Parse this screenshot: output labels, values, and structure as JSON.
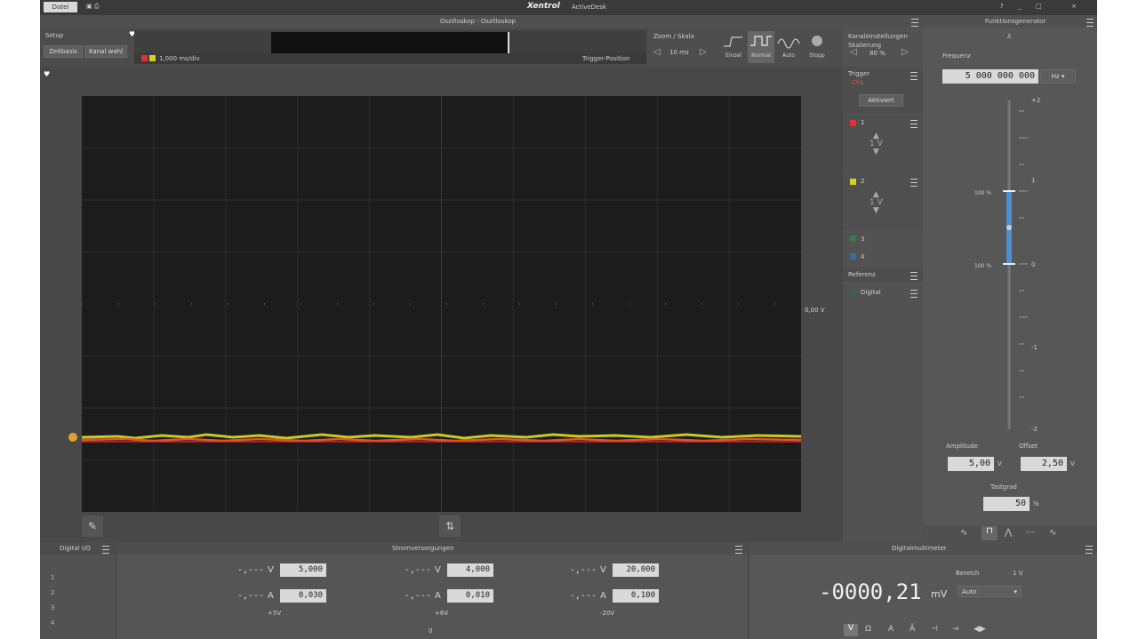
{
  "titlebar": {
    "tab_label": "Datei",
    "logo": "Xentrol",
    "app_name": "ActiveDesk",
    "window_controls": [
      "?",
      "_",
      "□",
      "×"
    ]
  },
  "oscilloscope": {
    "header": "Oszilloskop · Oszilloskop",
    "left_label": "Setup",
    "buttons": [
      "Zeitbasis",
      "Kanal wahl"
    ],
    "timebase_readout": "1,000 ms/div",
    "trigger_position": "Trigger-Position",
    "zoom_label": "Zoom / Skala",
    "zoom_value": "10 ms",
    "mode_buttons": [
      "Einzel",
      "Normal",
      "Auto",
      "Stopp"
    ],
    "right_marker_label": "0,00 V"
  },
  "right_controls": {
    "header": "Kanaleinstellungen",
    "scale_label": "Skalierung",
    "scale_value": "80 %",
    "trigger_label": "Trigger",
    "trigger_sub": "Ch1",
    "trigger_button": "Aktiviert",
    "channels": [
      {
        "label": "1",
        "color": "#e03030",
        "scale": "1 V"
      },
      {
        "label": "2",
        "color": "#d8d020",
        "scale": "1 V"
      }
    ],
    "extra_channels": [
      {
        "label": "3",
        "color": "#3a7a4a"
      },
      {
        "label": "4",
        "color": "#3a6aa0"
      }
    ],
    "reference_label": "Referenz",
    "reference_item": "Digital"
  },
  "generator": {
    "header": "Funktionsgenerator",
    "freq_label": "Frequenz",
    "freq_value": "5 000 000 000",
    "freq_unit": "Hz",
    "slider_top": "+2",
    "slider_bottom": "-2",
    "slider_marks": [
      "1",
      "0",
      "-1"
    ],
    "slider_hi": "100 %",
    "slider_lo": "100 %",
    "amp_label": "Amplitude",
    "amp_value": "5,00",
    "amp_unit": "V",
    "offset_label": "Offset",
    "offset_value": "2,50",
    "offset_unit": "V",
    "duty_label": "Tastgrad",
    "duty_value": "50",
    "duty_unit": "%",
    "waveforms": [
      "∿",
      "⊓",
      "⋀",
      "⋯",
      "∿"
    ]
  },
  "bottom_left": {
    "header": "Digital I/O",
    "rows": [
      "1",
      "2",
      "3",
      "4"
    ]
  },
  "power": {
    "header": "Stromversorgungen",
    "channels": [
      {
        "v_reading": "-,---",
        "v_unit": "V",
        "v_set": "5,000",
        "a_reading": "-,---",
        "a_unit": "A",
        "a_set": "0,030",
        "label": "+5V"
      },
      {
        "v_reading": "-,---",
        "v_unit": "V",
        "v_set": "4,000",
        "a_reading": "-,---",
        "a_unit": "A",
        "a_set": "0,010",
        "label": "+6V"
      },
      {
        "v_reading": "-,---",
        "v_unit": "V",
        "v_set": "20,000",
        "a_reading": "-,---",
        "a_unit": "A",
        "a_set": "0,100",
        "label": "-20V"
      }
    ],
    "footer_marker": "0"
  },
  "dmm": {
    "header": "Digitalmultimeter",
    "range_label": "Bereich",
    "range_value": "1 V",
    "reading": "-0000,21",
    "unit": "mV",
    "mode": "Auto",
    "mode_buttons": [
      "V",
      "Ω",
      "A",
      "Ã",
      "⊣",
      "→",
      "◀▶"
    ]
  }
}
